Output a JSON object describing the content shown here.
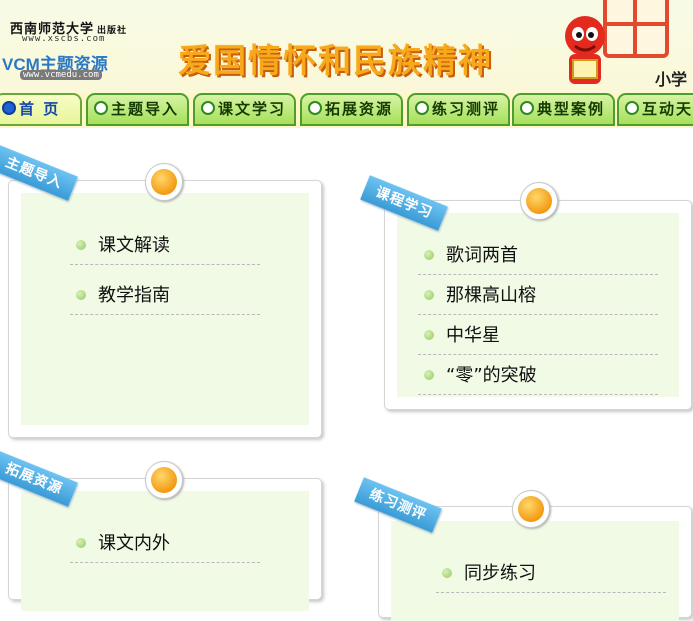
{
  "header": {
    "publisher_name": "西南师范大学",
    "publisher_suffix": "出版社",
    "publisher_url": "www.xscbs.com",
    "brand": "VCM主题资源",
    "brand_url": "www.vcmedu.com",
    "title": "爱国情怀和民族精神",
    "subtitle": "小学"
  },
  "nav": {
    "tabs": [
      {
        "label": "首  页",
        "active": true
      },
      {
        "label": "主题导入"
      },
      {
        "label": "课文学习"
      },
      {
        "label": "拓展资源"
      },
      {
        "label": "练习测评"
      },
      {
        "label": "典型案例"
      },
      {
        "label": "互动天"
      }
    ]
  },
  "sections": {
    "theme_intro": {
      "label": "主题导入",
      "items": [
        "课文解读",
        "教学指南"
      ]
    },
    "text_study": {
      "label": "课程学习",
      "items": [
        "歌词两首",
        "那棵高山榕",
        "中华星",
        "“零”的突破"
      ]
    },
    "extension": {
      "label": "拓展资源",
      "items": [
        "课文内外"
      ]
    },
    "practice": {
      "label": "练习测评",
      "items": [
        "同步练习"
      ]
    }
  },
  "colors": {
    "accent": "#f6aa1b",
    "nav_green": "#a7e05b",
    "badge_blue": "#3a9bd6"
  }
}
